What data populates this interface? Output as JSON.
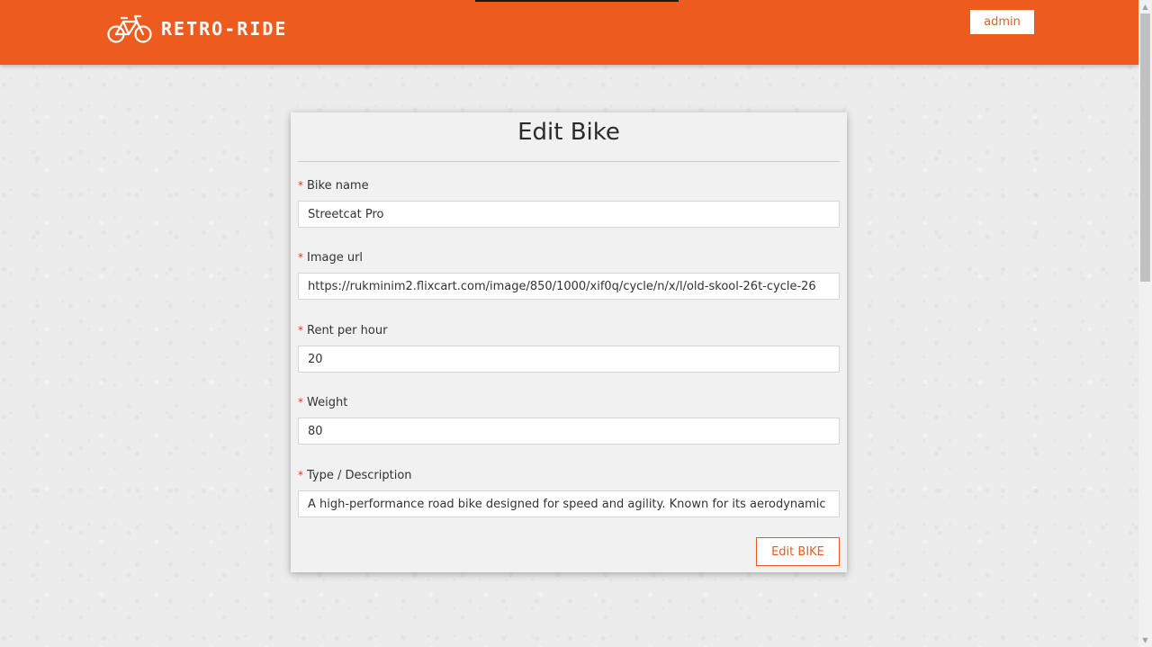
{
  "header": {
    "brand": "RETRO-RIDE",
    "logo_icon": "bicycle-icon",
    "user_button": "admin",
    "colors": {
      "brand": "#ee5b1f",
      "text": "#ffffff"
    }
  },
  "form": {
    "title": "Edit Bike",
    "required_marker": "*",
    "fields": [
      {
        "label": "Bike name",
        "value": "Streetcat Pro"
      },
      {
        "label": "Image url",
        "value": "https://rukminim2.flixcart.com/image/850/1000/xif0q/cycle/n/x/l/old-skool-26t-cycle-26"
      },
      {
        "label": "Rent per hour",
        "value": "20"
      },
      {
        "label": "Weight",
        "value": "80"
      },
      {
        "label": "Type / Description",
        "value": "A high-performance road bike designed for speed and agility. Known for its aerodynamic"
      }
    ],
    "submit_label": "Edit BIKE"
  },
  "scrollbar": {
    "up_icon": "triangle-up-icon",
    "down_icon": "triangle-down-icon"
  }
}
